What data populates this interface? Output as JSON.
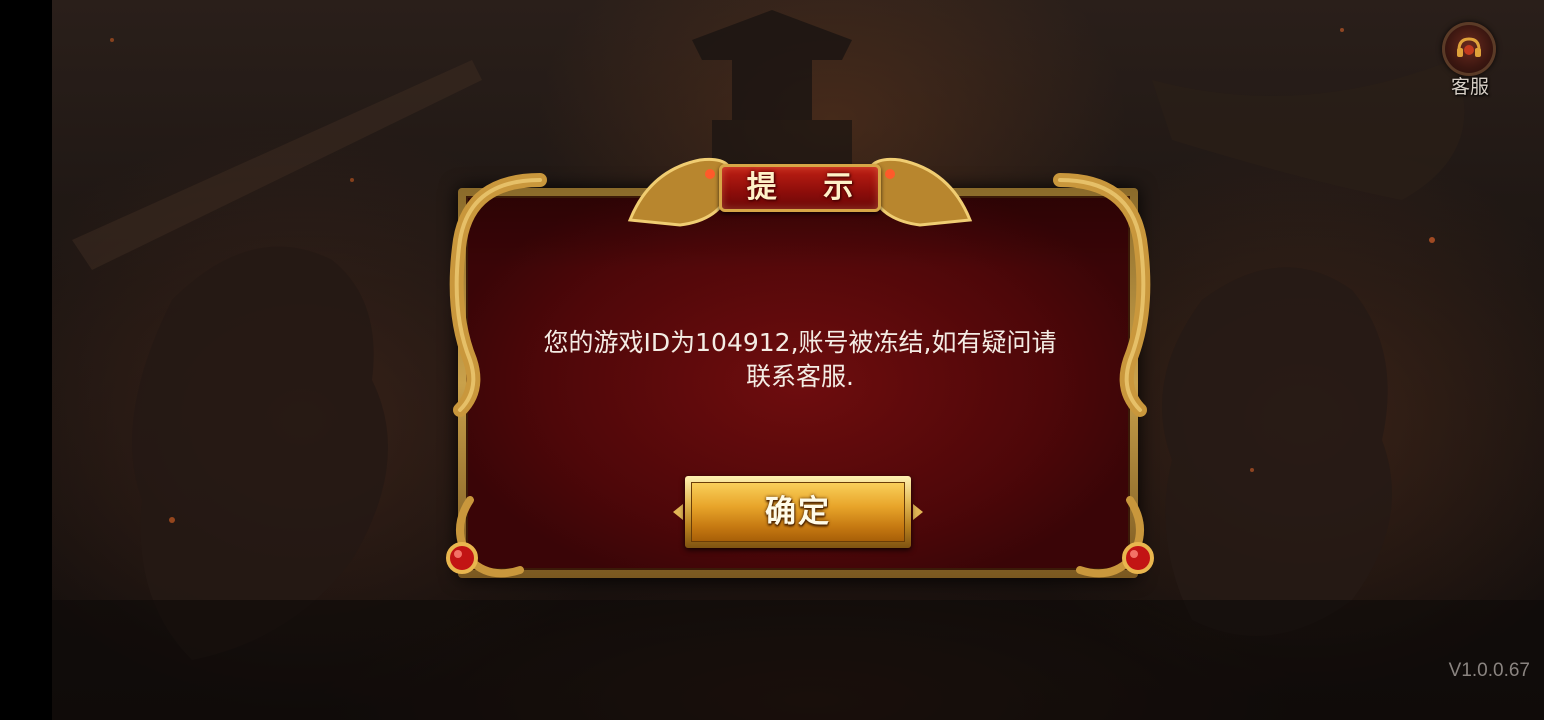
{
  "dialog": {
    "title": "提 示",
    "message_line1": "您的游戏ID为104912,账号被冻结,如有疑问请",
    "message_line2": "联系客服.",
    "confirm_label": "确定"
  },
  "customer_service": {
    "label": "客服",
    "icon": "customer-service-icon"
  },
  "version": "V1.0.0.67",
  "colors": {
    "panel_red": "#5a080a",
    "gold": "#c9a14b",
    "button_orange": "#e8a52a"
  }
}
